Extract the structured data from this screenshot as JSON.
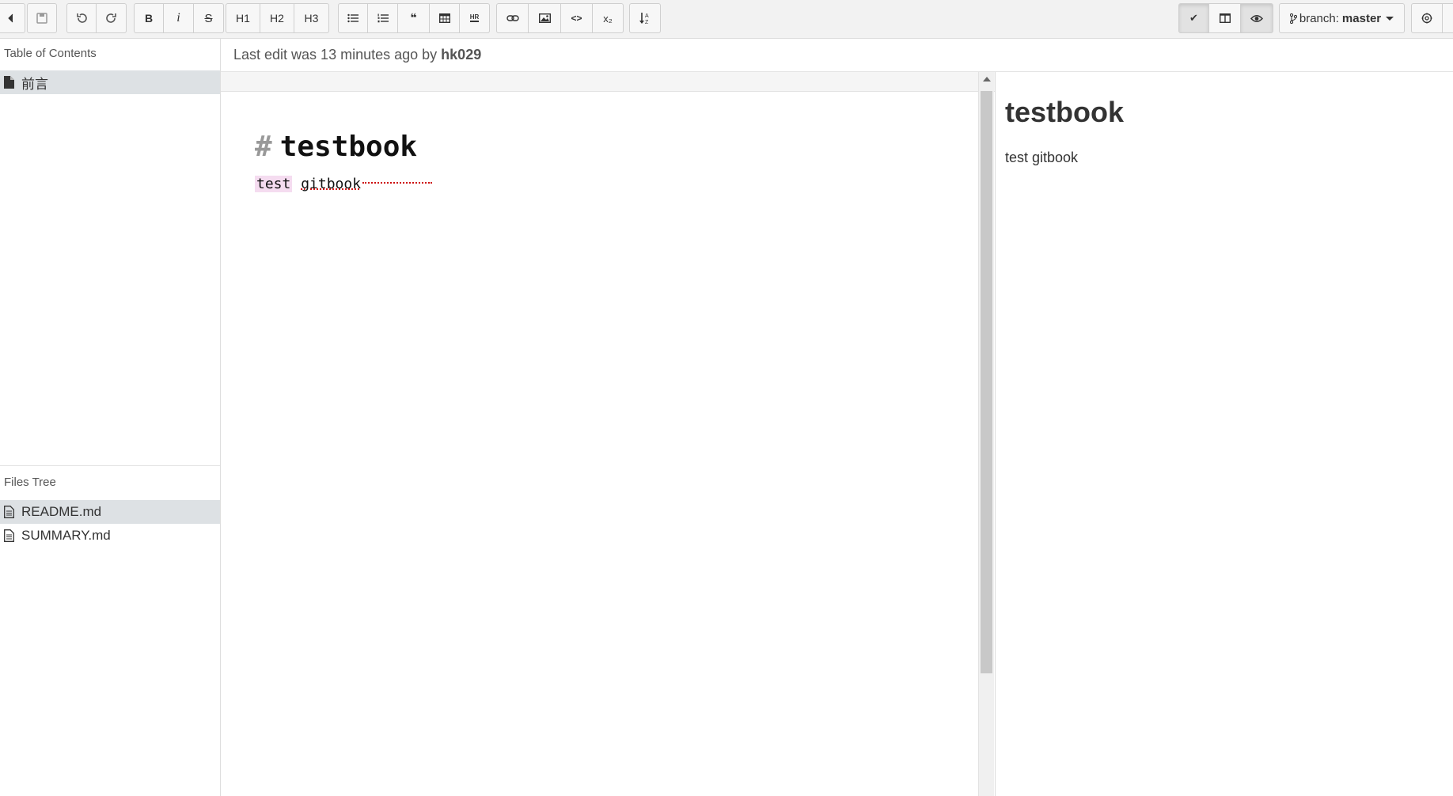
{
  "toolbar": {
    "back_icon": "chevron-left-icon",
    "save_icon": "floppy-disk-icon",
    "undo_icon": "undo-icon",
    "redo_icon": "redo-icon",
    "bold_label": "B",
    "italic_label": "i",
    "strike_label": "S",
    "h1_label": "H1",
    "h2_label": "H2",
    "h3_label": "H3",
    "ul_icon": "bullet-list-icon",
    "ol_icon": "numbered-list-icon",
    "quote_label": "❝",
    "table_icon": "table-icon",
    "hr_label": "HR",
    "link_icon": "link-icon",
    "image_icon": "image-icon",
    "code_label": "<>",
    "sub_label": "x₂",
    "sort_icon": "sort-icon",
    "check_label": "✔",
    "columns_icon": "columns-icon",
    "eye_icon": "eye-icon",
    "branch_prefix": "branch:",
    "branch_name": "master",
    "settings_icon": "gear-icon"
  },
  "sidebar": {
    "toc_title": "Table of Contents",
    "toc_items": [
      {
        "label": "前言",
        "icon": "file-icon",
        "selected": true
      }
    ],
    "files_title": "Files Tree",
    "files": [
      {
        "label": "README.md",
        "icon": "file-text-icon",
        "selected": true
      },
      {
        "label": "SUMMARY.md",
        "icon": "file-text-icon",
        "selected": false
      }
    ]
  },
  "edit_info": {
    "prefix": "Last edit was 13 minutes ago by",
    "user": "hk029"
  },
  "editor": {
    "heading_mark": "#",
    "heading_text": "testbook",
    "para_word1": "test",
    "para_word2": "gitbook"
  },
  "preview": {
    "heading": "testbook",
    "paragraph": "test gitbook"
  }
}
